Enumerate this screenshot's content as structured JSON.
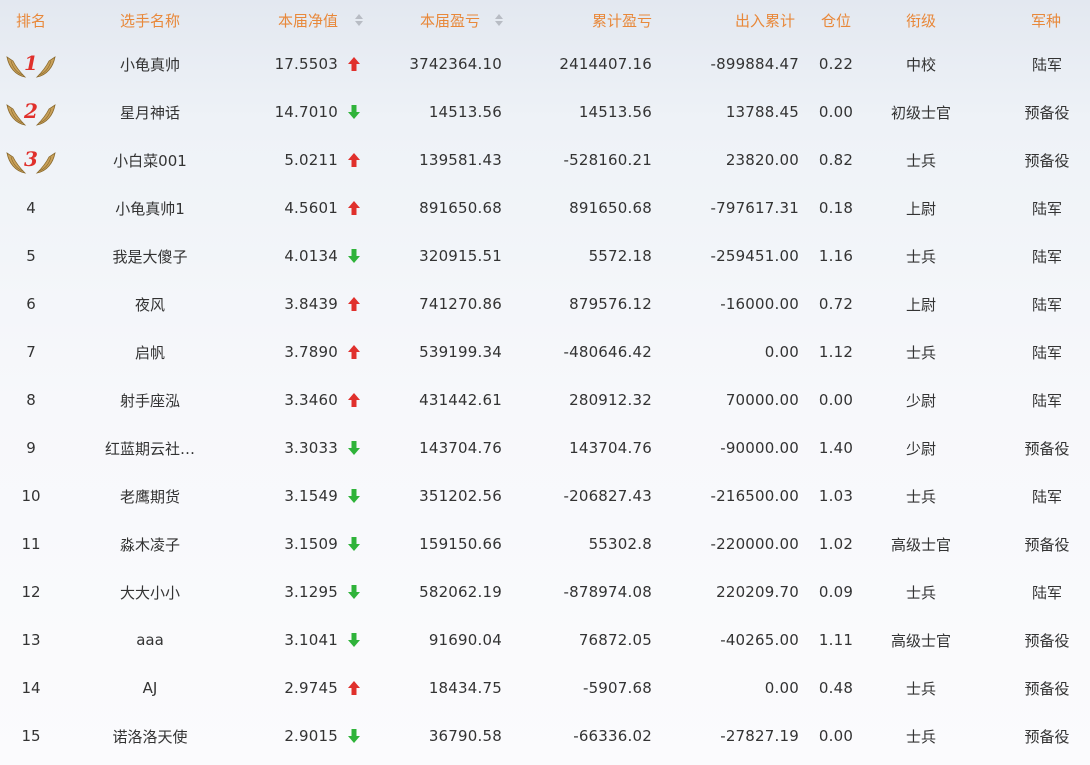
{
  "columns": {
    "rank": "排名",
    "name": "选手名称",
    "nav": "本届净值",
    "current_pl": "本届盈亏",
    "cumulative_pl": "累计盈亏",
    "in_out": "出入累计",
    "position": "仓位",
    "level": "衔级",
    "arm": "军种"
  },
  "colors": {
    "header_text": "#e8883a",
    "up_arrow": "#e0302c",
    "down_arrow": "#2fb33a",
    "medal_number": "#e0302c",
    "medal_wing": "#c9a15a"
  },
  "rows": [
    {
      "rank": "1",
      "name": "小龟真帅",
      "nav": "17.5503",
      "trend": "up",
      "current_pl": "3742364.10",
      "cumulative_pl": "2414407.16",
      "in_out": "-899884.47",
      "position": "0.22",
      "level": "中校",
      "arm": "陆军"
    },
    {
      "rank": "2",
      "name": "星月神话",
      "nav": "14.7010",
      "trend": "down",
      "current_pl": "14513.56",
      "cumulative_pl": "14513.56",
      "in_out": "13788.45",
      "position": "0.00",
      "level": "初级士官",
      "arm": "预备役"
    },
    {
      "rank": "3",
      "name": "小白菜001",
      "nav": "5.0211",
      "trend": "up",
      "current_pl": "139581.43",
      "cumulative_pl": "-528160.21",
      "in_out": "23820.00",
      "position": "0.82",
      "level": "士兵",
      "arm": "预备役"
    },
    {
      "rank": "4",
      "name": "小龟真帅1",
      "nav": "4.5601",
      "trend": "up",
      "current_pl": "891650.68",
      "cumulative_pl": "891650.68",
      "in_out": "-797617.31",
      "position": "0.18",
      "level": "上尉",
      "arm": "陆军"
    },
    {
      "rank": "5",
      "name": "我是大傻子",
      "nav": "4.0134",
      "trend": "down",
      "current_pl": "320915.51",
      "cumulative_pl": "5572.18",
      "in_out": "-259451.00",
      "position": "1.16",
      "level": "士兵",
      "arm": "陆军"
    },
    {
      "rank": "6",
      "name": "夜风",
      "nav": "3.8439",
      "trend": "up",
      "current_pl": "741270.86",
      "cumulative_pl": "879576.12",
      "in_out": "-16000.00",
      "position": "0.72",
      "level": "上尉",
      "arm": "陆军"
    },
    {
      "rank": "7",
      "name": "启帆",
      "nav": "3.7890",
      "trend": "up",
      "current_pl": "539199.34",
      "cumulative_pl": "-480646.42",
      "in_out": "0.00",
      "position": "1.12",
      "level": "士兵",
      "arm": "陆军"
    },
    {
      "rank": "8",
      "name": "射手座泓",
      "nav": "3.3460",
      "trend": "up",
      "current_pl": "431442.61",
      "cumulative_pl": "280912.32",
      "in_out": "70000.00",
      "position": "0.00",
      "level": "少尉",
      "arm": "陆军"
    },
    {
      "rank": "9",
      "name": "红蓝期云社…",
      "nav": "3.3033",
      "trend": "down",
      "current_pl": "143704.76",
      "cumulative_pl": "143704.76",
      "in_out": "-90000.00",
      "position": "1.40",
      "level": "少尉",
      "arm": "预备役"
    },
    {
      "rank": "10",
      "name": "老鹰期货",
      "nav": "3.1549",
      "trend": "down",
      "current_pl": "351202.56",
      "cumulative_pl": "-206827.43",
      "in_out": "-216500.00",
      "position": "1.03",
      "level": "士兵",
      "arm": "陆军"
    },
    {
      "rank": "11",
      "name": "淼木凌子",
      "nav": "3.1509",
      "trend": "down",
      "current_pl": "159150.66",
      "cumulative_pl": "55302.8",
      "in_out": "-220000.00",
      "position": "1.02",
      "level": "高级士官",
      "arm": "预备役"
    },
    {
      "rank": "12",
      "name": "大大小小",
      "nav": "3.1295",
      "trend": "down",
      "current_pl": "582062.19",
      "cumulative_pl": "-878974.08",
      "in_out": "220209.70",
      "position": "0.09",
      "level": "士兵",
      "arm": "陆军"
    },
    {
      "rank": "13",
      "name": "aaa",
      "nav": "3.1041",
      "trend": "down",
      "current_pl": "91690.04",
      "cumulative_pl": "76872.05",
      "in_out": "-40265.00",
      "position": "1.11",
      "level": "高级士官",
      "arm": "预备役"
    },
    {
      "rank": "14",
      "name": "AJ",
      "nav": "2.9745",
      "trend": "up",
      "current_pl": "18434.75",
      "cumulative_pl": "-5907.68",
      "in_out": "0.00",
      "position": "0.48",
      "level": "士兵",
      "arm": "预备役"
    },
    {
      "rank": "15",
      "name": "诺洛洛天使",
      "nav": "2.9015",
      "trend": "down",
      "current_pl": "36790.58",
      "cumulative_pl": "-66336.02",
      "in_out": "-27827.19",
      "position": "0.00",
      "level": "士兵",
      "arm": "预备役"
    }
  ]
}
